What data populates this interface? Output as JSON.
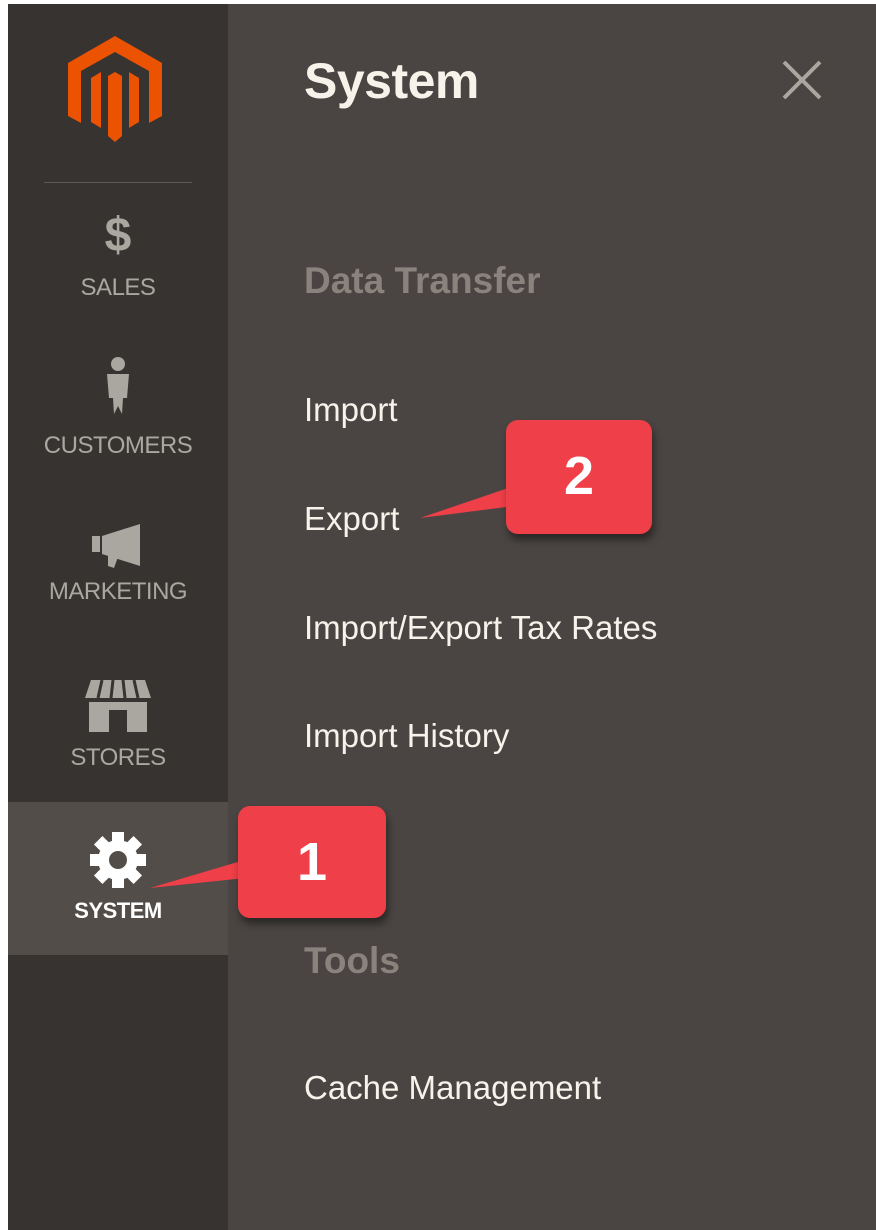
{
  "sidebar": {
    "logo_icon": "magento-logo-icon",
    "items": [
      {
        "label": "SALES",
        "icon": "dollar-icon"
      },
      {
        "label": "CUSTOMERS",
        "icon": "person-icon"
      },
      {
        "label": "MARKETING",
        "icon": "megaphone-icon"
      },
      {
        "label": "STORES",
        "icon": "storefront-icon"
      },
      {
        "label": "SYSTEM",
        "icon": "gear-icon",
        "active": true
      }
    ]
  },
  "panel": {
    "title": "System",
    "close_icon": "close-icon",
    "sections": [
      {
        "heading": "Data Transfer",
        "links": [
          "Import",
          "Export",
          "Import/Export Tax Rates",
          "Import History"
        ]
      },
      {
        "heading": "Tools",
        "links": [
          "Cache Management"
        ]
      }
    ]
  },
  "callouts": [
    {
      "number": "1",
      "target": "SYSTEM"
    },
    {
      "number": "2",
      "target": "Export"
    }
  ],
  "colors": {
    "sidebar_bg": "#373330",
    "panel_bg": "#4a4542",
    "active_item_bg": "#524d49",
    "logo_orange": "#eb5202",
    "callout_red": "#ef3f48",
    "section_heading": "#8a837d",
    "link_text": "#f7f3eb"
  }
}
